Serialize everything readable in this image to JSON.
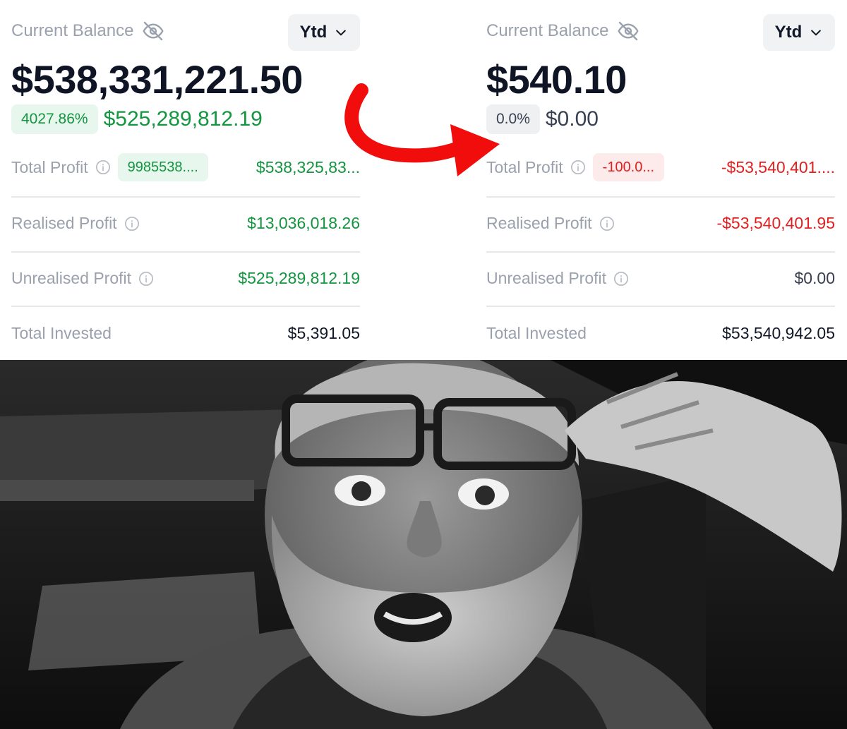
{
  "left_panel": {
    "balance_label": "Current Balance",
    "period": "Ytd",
    "balance": "$538,331,221.50",
    "change_pct": "4027.86%",
    "change_amount": "$525,289,812.19",
    "total_profit_label": "Total Profit",
    "total_profit_pct": "9985538....",
    "total_profit_value": "$538,325,83...",
    "realised_label": "Realised Profit",
    "realised_value": "$13,036,018.26",
    "unrealised_label": "Unrealised Profit",
    "unrealised_value": "$525,289,812.19",
    "invested_label": "Total Invested",
    "invested_value": "$5,391.05"
  },
  "right_panel": {
    "balance_label": "Current Balance",
    "period": "Ytd",
    "balance": "$540.10",
    "change_pct": "0.0%",
    "change_amount": "$0.00",
    "total_profit_label": "Total Profit",
    "total_profit_pct": "-100.0...",
    "total_profit_value": "-$53,540,401....",
    "realised_label": "Realised Profit",
    "realised_value": "-$53,540,401.95",
    "unrealised_label": "Unrealised Profit",
    "unrealised_value": "$0.00",
    "invested_label": "Total Invested",
    "invested_value": "$53,540,942.05"
  },
  "colors": {
    "positive": "#14953f",
    "negative": "#e3201f",
    "arrow": "#f20d0d",
    "muted": "#9aa1ad"
  },
  "icons": [
    "eye-slash-icon",
    "chevron-down-icon",
    "info-icon",
    "curved-arrow-icon"
  ]
}
